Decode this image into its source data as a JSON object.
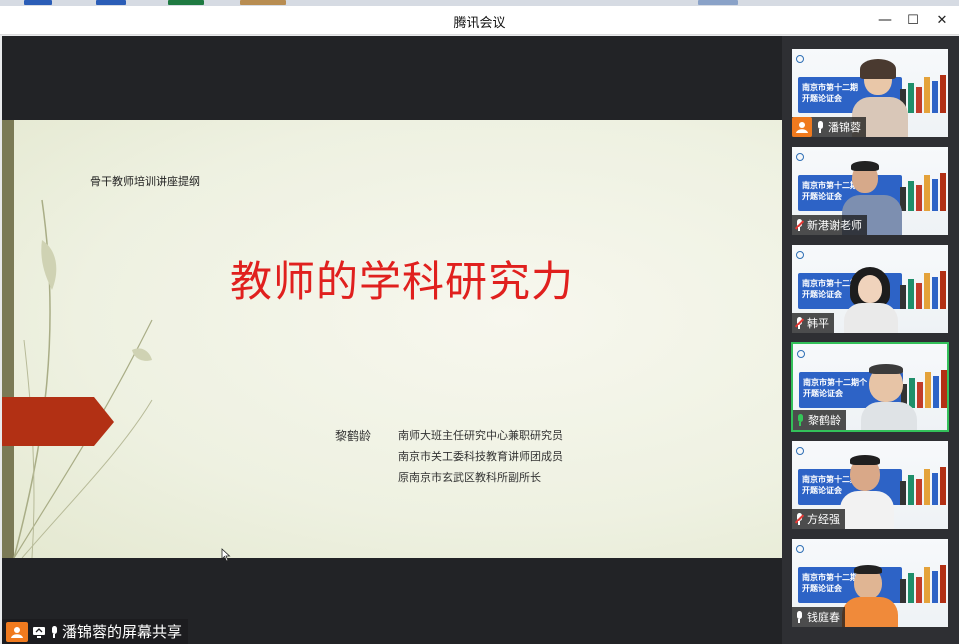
{
  "window": {
    "title": "腾讯会议",
    "minimize_label": "—",
    "maximize_label": "☐",
    "close_label": "✕"
  },
  "slide": {
    "header": "骨干教师培训讲座提纲",
    "title": "教师的学科研究力",
    "author": "黎鹤龄",
    "roles": [
      "南师大班主任研究中心兼职研究员",
      "南京市关工委科技教育讲师团成员",
      "原南京市玄武区教科所副所长"
    ]
  },
  "share_bar": {
    "label": "潘锦蓉的屏幕共享"
  },
  "participants": [
    {
      "name": "潘锦蓉",
      "mic": "on-white",
      "host": true,
      "active": false,
      "tile_text": "南京市第十二期\n开题论证会"
    },
    {
      "name": "新港谢老师",
      "mic": "muted",
      "host": false,
      "active": false,
      "tile_text": "南京市第十二期\n开题论证会"
    },
    {
      "name": "韩平",
      "mic": "muted",
      "host": false,
      "active": false,
      "tile_text": "南京市第十二期\n开题论证会"
    },
    {
      "name": "黎鹤龄",
      "mic": "speaking",
      "host": false,
      "active": true,
      "tile_text": "南京市第十二期个\n开题论证会"
    },
    {
      "name": "方经强",
      "mic": "muted",
      "host": false,
      "active": false,
      "tile_text": "南京市第十二期\n开题论证会"
    },
    {
      "name": "钱庭春",
      "mic": "on-white",
      "host": false,
      "active": false,
      "tile_text": "南京市第十二期个\n开题论证会"
    }
  ],
  "colors": {
    "slide_title": "#e0201e",
    "accent_orange": "#f07a1e",
    "active_border": "#33c05a",
    "stage_bg": "#222326"
  }
}
